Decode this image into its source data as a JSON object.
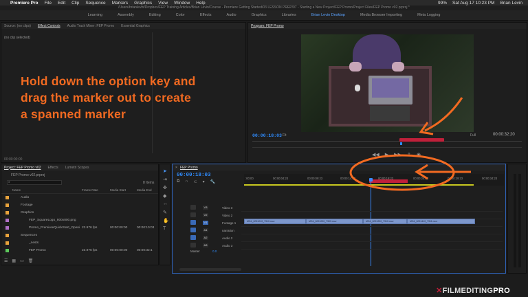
{
  "menubar": {
    "apple": "",
    "app": "Premiere Pro",
    "items": [
      "File",
      "Edit",
      "Clip",
      "Sequence",
      "Markers",
      "Graphics",
      "View",
      "Window",
      "Help"
    ],
    "clock": "Sat Aug 17  10:23 PM",
    "user": "Brian Levin",
    "battery": "99%"
  },
  "path": "/Users/brianlevin/Dropbox/FEP Training Articles/Brian Levin/Course - Premiere Getting Started/03 LESSON PREP/07 - Starting a New Project/FEP Promo/Project Files/FEP Promo v02.prproj *",
  "workspaces": [
    "Learning",
    "Assembly",
    "Editing",
    "Color",
    "Effects",
    "Audio",
    "Graphics",
    "Libraries",
    "Brian Levin Desktop",
    "Media Browser Importing",
    "Meta Logging"
  ],
  "source_panel": {
    "tabs": [
      "Source: (no clips)",
      "Effect Controls",
      "Audio Track Mixer: FEP Promo",
      "Essential Graphics"
    ],
    "empty": "(no clip selected)",
    "timecode": "00:00:00:00"
  },
  "callout": "Hold down the option key and drag the marker out to create a spanned marker",
  "program": {
    "tab": "Program: FEP Promo",
    "timecode": "00:00:18:03",
    "fit": "Fit",
    "quality": "Full",
    "duration": "00:00:32:20"
  },
  "project": {
    "tabs": [
      "Project: FEP Promo v02",
      "Effects",
      "Lumetri Scopes"
    ],
    "file": "FEP Promo v02.prproj",
    "items_count": "8 Items",
    "columns": [
      "Name",
      "Frame Rate",
      "Media Start",
      "Media End"
    ],
    "rows": [
      {
        "name": "Audio",
        "rate": "",
        "start": "",
        "end": "",
        "color": "#e8a33c"
      },
      {
        "name": "Footage",
        "rate": "",
        "start": "",
        "end": "",
        "color": "#e8a33c"
      },
      {
        "name": "Graphics",
        "rate": "",
        "start": "",
        "end": "",
        "color": "#e8a33c"
      },
      {
        "name": "FEP_SquareLogo_800x800.png",
        "rate": "",
        "start": "",
        "end": "",
        "color": "#b070c8"
      },
      {
        "name": "Promo_PremiereQuickStart_Openi",
        "rate": "23.976 fps",
        "start": "00:00:00:00",
        "end": "00:00:10:03",
        "color": "#b070c8"
      },
      {
        "name": "Sequences",
        "rate": "",
        "start": "",
        "end": "",
        "color": "#e8a33c"
      },
      {
        "name": "_nests",
        "rate": "",
        "start": "",
        "end": "",
        "color": "#e8a33c"
      },
      {
        "name": "FEP Promo",
        "rate": "23.976 fps",
        "start": "00:00:00:00",
        "end": "00:00:32:1",
        "color": "#5cc85c"
      }
    ]
  },
  "timeline": {
    "tab": "FEP Promo",
    "timecode": "00:00:18:03",
    "ruler": [
      ":00:00",
      "00:00:04:23",
      "00:00:09:23",
      "00:00:14:23",
      "00:00:19:23",
      "00:00:24:23",
      "00:00:29:23",
      "00:00:34:23"
    ],
    "tracks": [
      {
        "id": "V3",
        "name": "Video 3"
      },
      {
        "id": "V2",
        "name": "Video 2"
      },
      {
        "id": "V1",
        "name": "Footage 1"
      },
      {
        "id": "A1",
        "name": "narration"
      },
      {
        "id": "A2",
        "name": "Audio 2"
      },
      {
        "id": "A3",
        "name": "Audio 3"
      }
    ],
    "master": "Master",
    "master_val": "0.0",
    "clips": [
      "MG4_0001010_7310.mov",
      "MG4_0001020_7309.mov",
      "MG4_0001230_7310.mov",
      "MG4_0001410_7311.mov"
    ]
  },
  "brand": {
    "name": "FILMEDITING",
    "bold": "PRO"
  }
}
